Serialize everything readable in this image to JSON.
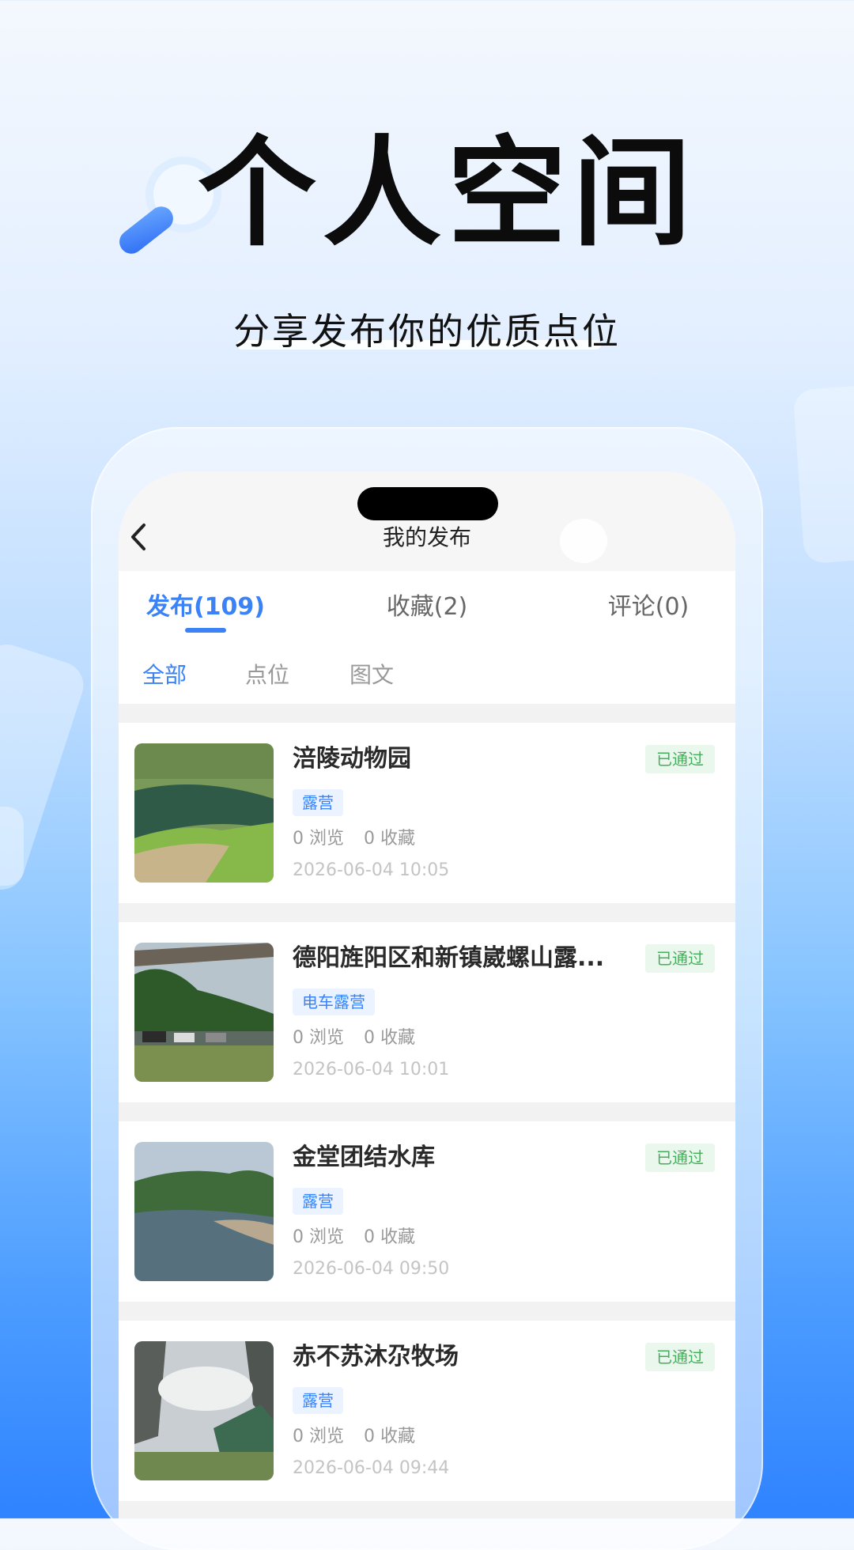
{
  "hero": {
    "title": "个人空间",
    "subtitle": "分享发布你的优质点位"
  },
  "nav": {
    "title": "我的发布"
  },
  "tabs": [
    {
      "label": "发布(109)",
      "active": true
    },
    {
      "label": "收藏(2)",
      "active": false
    },
    {
      "label": "评论(0)",
      "active": false
    }
  ],
  "filters": [
    {
      "label": "全部",
      "active": true
    },
    {
      "label": "点位",
      "active": false
    },
    {
      "label": "图文",
      "active": false
    }
  ],
  "posts": [
    {
      "title": "涪陵动物园",
      "tag": "露营",
      "views": "0 浏览",
      "favorites": "0 收藏",
      "date": "2026-06-04 10:05",
      "status": "已通过",
      "thumb": "river-field"
    },
    {
      "title": "德阳旌阳区和新镇崴螺山露...",
      "tag": "电车露营",
      "views": "0 浏览",
      "favorites": "0 收藏",
      "date": "2026-06-04 10:01",
      "status": "已通过",
      "thumb": "campsite-cars"
    },
    {
      "title": "金堂团结水库",
      "tag": "露营",
      "views": "0 浏览",
      "favorites": "0 收藏",
      "date": "2026-06-04 09:50",
      "status": "已通过",
      "thumb": "reservoir"
    },
    {
      "title": "赤不苏沐尕牧场",
      "tag": "露营",
      "views": "0 浏览",
      "favorites": "0 收藏",
      "date": "2026-06-04 09:44",
      "status": "已通过",
      "thumb": "mountain-tent"
    }
  ],
  "colors": {
    "accent": "#3b82f6",
    "status_green": "#41b259",
    "status_bg": "#eaf7ec",
    "tag_bg": "#eaf3ff"
  }
}
